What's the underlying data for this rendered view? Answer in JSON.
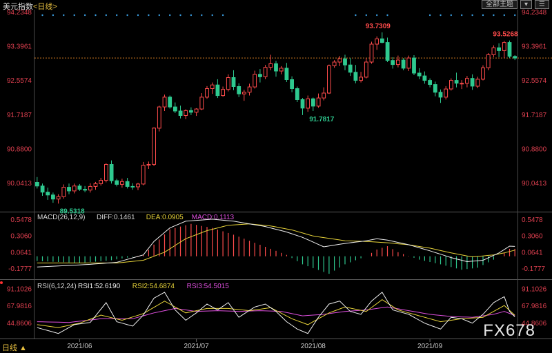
{
  "header": {
    "title": "美元指数",
    "period": "<日线>",
    "buttons": [
      "全部主题",
      "▾",
      "☰"
    ]
  },
  "footer": {
    "period_tab": "日线 ▲"
  },
  "watermark": "FX678",
  "colors": {
    "up": "#ff4b4b",
    "down": "#2ec98f",
    "dif": "#f0f0f0",
    "dea": "#e8d43a",
    "macd": "#e050e0",
    "rsi1": "#f0f0f0",
    "rsi2": "#e8d43a",
    "rsi3": "#e050e0",
    "axis_text": "#e04050",
    "marker_dots": "#3a9de0",
    "last_price_line": "#d07a20"
  },
  "chart_data": [
    {
      "type": "candlestick",
      "title": "美元指数<日线>",
      "y_ticks": [
        "94.2348",
        "93.3961",
        "92.5574",
        "91.7187",
        "90.8800",
        "90.0413"
      ],
      "ylim": [
        89.45,
        94.2348
      ],
      "x_ticks": [
        "2021/06",
        "2021/07",
        "2021/08",
        "2021/09"
      ],
      "x_tick_index": [
        8,
        30,
        52,
        74
      ],
      "annotations": [
        {
          "label": "89.5318",
          "index": 4,
          "kind": "low"
        },
        {
          "label": "91.7817",
          "index": 51,
          "kind": "low"
        },
        {
          "label": "93.7309",
          "index": 65,
          "kind": "high"
        },
        {
          "label": "93.5268",
          "index": 89,
          "kind": "high"
        }
      ],
      "last_price": 93.1,
      "candles": [
        [
          90.05,
          90.18,
          89.9,
          89.96
        ],
        [
          89.96,
          90.02,
          89.72,
          89.81
        ],
        [
          89.81,
          89.92,
          89.62,
          89.74
        ],
        [
          89.74,
          89.8,
          89.55,
          89.64
        ],
        [
          89.64,
          89.76,
          89.53,
          89.7
        ],
        [
          89.7,
          90.0,
          89.65,
          89.93
        ],
        [
          89.93,
          90.02,
          89.76,
          89.84
        ],
        [
          89.84,
          90.02,
          89.78,
          89.96
        ],
        [
          89.96,
          90.01,
          89.84,
          89.88
        ],
        [
          89.88,
          89.96,
          89.81,
          89.86
        ],
        [
          89.86,
          90.03,
          89.8,
          89.95
        ],
        [
          89.95,
          90.06,
          89.87,
          90.02
        ],
        [
          90.02,
          90.16,
          89.97,
          90.1
        ],
        [
          90.1,
          90.52,
          90.05,
          90.49
        ],
        [
          90.49,
          90.59,
          90.02,
          90.09
        ],
        [
          90.09,
          90.14,
          89.95,
          90.0
        ],
        [
          90.0,
          90.14,
          89.92,
          90.07
        ],
        [
          90.07,
          90.16,
          89.9,
          89.95
        ],
        [
          89.95,
          90.03,
          89.87,
          89.94
        ],
        [
          89.94,
          90.04,
          89.86,
          90.01
        ],
        [
          90.01,
          90.55,
          89.98,
          90.47
        ],
        [
          90.47,
          90.56,
          90.38,
          90.49
        ],
        [
          90.49,
          91.4,
          90.45,
          91.38
        ],
        [
          91.38,
          91.93,
          91.3,
          91.9
        ],
        [
          91.9,
          92.2,
          91.8,
          92.14
        ],
        [
          92.14,
          92.18,
          91.86,
          91.9
        ],
        [
          91.9,
          92.01,
          91.75,
          91.8
        ],
        [
          91.8,
          91.93,
          91.62,
          91.69
        ],
        [
          91.69,
          91.84,
          91.6,
          91.81
        ],
        [
          91.81,
          91.89,
          91.7,
          91.77
        ],
        [
          91.77,
          91.87,
          91.68,
          91.85
        ],
        [
          91.85,
          92.24,
          91.82,
          92.14
        ],
        [
          92.14,
          92.41,
          92.1,
          92.35
        ],
        [
          92.35,
          92.5,
          92.22,
          92.44
        ],
        [
          92.44,
          92.58,
          92.12,
          92.18
        ],
        [
          92.18,
          92.4,
          92.15,
          92.33
        ],
        [
          92.33,
          92.7,
          92.28,
          92.62
        ],
        [
          92.62,
          92.8,
          92.31,
          92.4
        ],
        [
          92.4,
          92.48,
          92.14,
          92.22
        ],
        [
          92.22,
          92.32,
          92.05,
          92.26
        ],
        [
          92.26,
          92.47,
          92.18,
          92.39
        ],
        [
          92.39,
          92.79,
          92.35,
          92.7
        ],
        [
          92.7,
          92.83,
          92.5,
          92.64
        ],
        [
          92.64,
          92.93,
          92.58,
          92.87
        ],
        [
          92.87,
          93.18,
          92.8,
          92.96
        ],
        [
          92.96,
          93.03,
          92.64,
          92.78
        ],
        [
          92.78,
          92.9,
          92.7,
          92.85
        ],
        [
          92.85,
          92.98,
          92.51,
          92.57
        ],
        [
          92.57,
          92.65,
          92.26,
          92.35
        ],
        [
          92.35,
          92.4,
          92.02,
          92.08
        ],
        [
          92.08,
          92.12,
          91.7,
          91.87
        ],
        [
          91.87,
          92.18,
          91.78,
          92.1
        ],
        [
          92.1,
          92.13,
          91.8,
          91.92
        ],
        [
          91.92,
          92.23,
          91.88,
          92.12
        ],
        [
          92.12,
          92.38,
          92.06,
          92.24
        ],
        [
          92.24,
          92.94,
          92.22,
          92.91
        ],
        [
          92.91,
          93.05,
          92.86,
          93.0
        ],
        [
          93.0,
          93.15,
          92.9,
          93.08
        ],
        [
          93.08,
          93.18,
          92.8,
          92.93
        ],
        [
          92.93,
          93.1,
          92.66,
          92.75
        ],
        [
          92.75,
          92.93,
          92.48,
          92.55
        ],
        [
          92.55,
          92.76,
          92.5,
          92.63
        ],
        [
          92.63,
          93.1,
          92.6,
          93.0
        ],
        [
          93.0,
          93.5,
          92.96,
          93.44
        ],
        [
          93.44,
          93.63,
          93.3,
          93.57
        ],
        [
          93.57,
          93.73,
          93.46,
          93.48
        ],
        [
          93.48,
          93.6,
          93.0,
          93.04
        ],
        [
          93.04,
          93.12,
          92.84,
          92.94
        ],
        [
          92.94,
          93.16,
          92.87,
          93.05
        ],
        [
          93.05,
          93.1,
          92.8,
          92.85
        ],
        [
          92.85,
          93.16,
          92.78,
          93.1
        ],
        [
          93.1,
          93.17,
          92.68,
          92.73
        ],
        [
          92.73,
          92.85,
          92.58,
          92.66
        ],
        [
          92.66,
          92.77,
          92.47,
          92.55
        ],
        [
          92.55,
          92.6,
          92.38,
          92.45
        ],
        [
          92.45,
          92.52,
          92.16,
          92.26
        ],
        [
          92.26,
          92.33,
          92.0,
          92.14
        ],
        [
          92.14,
          92.41,
          92.08,
          92.34
        ],
        [
          92.34,
          92.6,
          92.3,
          92.55
        ],
        [
          92.55,
          92.74,
          92.38,
          92.48
        ],
        [
          92.48,
          92.56,
          92.34,
          92.48
        ],
        [
          92.48,
          92.66,
          92.38,
          92.6
        ],
        [
          92.6,
          92.7,
          92.32,
          92.41
        ],
        [
          92.41,
          92.64,
          92.36,
          92.58
        ],
        [
          92.58,
          92.92,
          92.55,
          92.86
        ],
        [
          92.86,
          93.22,
          92.8,
          93.18
        ],
        [
          93.18,
          93.41,
          93.12,
          93.35
        ],
        [
          93.35,
          93.46,
          93.12,
          93.28
        ],
        [
          93.28,
          93.52,
          93.1,
          93.48
        ],
        [
          93.48,
          93.53,
          93.1,
          93.14
        ],
        [
          93.14,
          93.17,
          93.05,
          93.1
        ]
      ]
    },
    {
      "type": "line",
      "title": "MACD(26,12,9)",
      "labels": [
        {
          "name": "DIFF",
          "text": "DIFF:0.1461"
        },
        {
          "name": "DEA",
          "text": "DEA:0.0905"
        },
        {
          "name": "MACD",
          "text": "MACD:0.1113"
        }
      ],
      "y_ticks": [
        "0.5478",
        "0.3060",
        "0.0641",
        "-0.1777"
      ],
      "ylim": [
        -0.3,
        0.6
      ],
      "macd_keypoints": [
        [
          0,
          -0.07
        ],
        [
          8,
          -0.1
        ],
        [
          14,
          -0.06
        ],
        [
          20,
          0.02
        ],
        [
          25,
          0.4
        ],
        [
          29,
          0.48
        ],
        [
          33,
          0.42
        ],
        [
          37,
          0.32
        ],
        [
          43,
          0.14
        ],
        [
          47,
          0.02
        ],
        [
          50,
          -0.12
        ],
        [
          55,
          -0.26
        ],
        [
          58,
          -0.12
        ],
        [
          62,
          0.0
        ],
        [
          64,
          0.1
        ],
        [
          66,
          0.15
        ],
        [
          68,
          0.06
        ],
        [
          72,
          -0.05
        ],
        [
          76,
          -0.12
        ],
        [
          80,
          -0.2
        ],
        [
          83,
          -0.17
        ],
        [
          86,
          -0.05
        ],
        [
          88,
          0.05
        ],
        [
          89,
          0.11
        ],
        [
          90,
          0.11
        ]
      ],
      "diff_keypoints": [
        [
          0,
          -0.16
        ],
        [
          10,
          -0.12
        ],
        [
          15,
          -0.09
        ],
        [
          20,
          0.02
        ],
        [
          22,
          0.22
        ],
        [
          25,
          0.42
        ],
        [
          28,
          0.52
        ],
        [
          33,
          0.55
        ],
        [
          37,
          0.52
        ],
        [
          43,
          0.44
        ],
        [
          47,
          0.36
        ],
        [
          50,
          0.28
        ],
        [
          54,
          0.14
        ],
        [
          58,
          0.19
        ],
        [
          62,
          0.23
        ],
        [
          64,
          0.26
        ],
        [
          66,
          0.24
        ],
        [
          70,
          0.17
        ],
        [
          74,
          0.08
        ],
        [
          78,
          -0.02
        ],
        [
          81,
          -0.08
        ],
        [
          84,
          -0.06
        ],
        [
          87,
          0.05
        ],
        [
          89,
          0.15
        ],
        [
          90,
          0.1461
        ]
      ],
      "dea_keypoints": [
        [
          0,
          -0.1
        ],
        [
          15,
          -0.1
        ],
        [
          20,
          -0.06
        ],
        [
          24,
          0.06
        ],
        [
          28,
          0.26
        ],
        [
          32,
          0.38
        ],
        [
          36,
          0.46
        ],
        [
          40,
          0.48
        ],
        [
          44,
          0.45
        ],
        [
          48,
          0.39
        ],
        [
          52,
          0.3
        ],
        [
          58,
          0.23
        ],
        [
          62,
          0.22
        ],
        [
          66,
          0.2
        ],
        [
          70,
          0.17
        ],
        [
          74,
          0.12
        ],
        [
          78,
          0.05
        ],
        [
          82,
          -0.01
        ],
        [
          86,
          0.02
        ],
        [
          88,
          0.05
        ],
        [
          90,
          0.0905
        ]
      ]
    },
    {
      "type": "line",
      "title": "RSI(6,12,24)",
      "labels": [
        {
          "name": "RSI1",
          "text": "RSI1:52.6190"
        },
        {
          "name": "RSI2",
          "text": "RSI2:54.6874"
        },
        {
          "name": "RSI3",
          "text": "RSI3:54.5015"
        }
      ],
      "y_ticks": [
        "91.1026",
        "67.9816",
        "44.8606"
      ],
      "ylim": [
        25,
        100
      ],
      "rsi1_keypoints": [
        [
          0,
          38
        ],
        [
          4,
          30
        ],
        [
          7,
          42
        ],
        [
          10,
          45
        ],
        [
          13,
          72
        ],
        [
          15,
          46
        ],
        [
          18,
          40
        ],
        [
          20,
          55
        ],
        [
          22,
          78
        ],
        [
          24,
          86
        ],
        [
          26,
          62
        ],
        [
          28,
          48
        ],
        [
          30,
          58
        ],
        [
          32,
          70
        ],
        [
          34,
          62
        ],
        [
          36,
          72
        ],
        [
          38,
          52
        ],
        [
          41,
          66
        ],
        [
          43,
          70
        ],
        [
          45,
          60
        ],
        [
          47,
          46
        ],
        [
          49,
          36
        ],
        [
          51,
          30
        ],
        [
          53,
          52
        ],
        [
          55,
          70
        ],
        [
          57,
          74
        ],
        [
          59,
          60
        ],
        [
          61,
          56
        ],
        [
          63,
          74
        ],
        [
          65,
          86
        ],
        [
          67,
          62
        ],
        [
          70,
          56
        ],
        [
          73,
          44
        ],
        [
          76,
          36
        ],
        [
          78,
          52
        ],
        [
          80,
          50
        ],
        [
          82,
          44
        ],
        [
          84,
          56
        ],
        [
          86,
          72
        ],
        [
          88,
          80
        ],
        [
          89,
          60
        ],
        [
          90,
          52.6
        ]
      ],
      "rsi2_keypoints": [
        [
          0,
          42
        ],
        [
          4,
          38
        ],
        [
          8,
          44
        ],
        [
          12,
          55
        ],
        [
          16,
          48
        ],
        [
          20,
          57
        ],
        [
          24,
          74
        ],
        [
          28,
          58
        ],
        [
          32,
          64
        ],
        [
          36,
          64
        ],
        [
          40,
          61
        ],
        [
          44,
          65
        ],
        [
          48,
          50
        ],
        [
          51,
          42
        ],
        [
          55,
          58
        ],
        [
          58,
          66
        ],
        [
          62,
          60
        ],
        [
          65,
          76
        ],
        [
          68,
          62
        ],
        [
          72,
          54
        ],
        [
          76,
          46
        ],
        [
          80,
          50
        ],
        [
          84,
          52
        ],
        [
          88,
          68
        ],
        [
          90,
          54.7
        ]
      ],
      "rsi3_keypoints": [
        [
          0,
          46
        ],
        [
          6,
          45
        ],
        [
          12,
          50
        ],
        [
          18,
          50
        ],
        [
          22,
          58
        ],
        [
          26,
          64
        ],
        [
          30,
          60
        ],
        [
          34,
          61
        ],
        [
          38,
          60
        ],
        [
          42,
          61
        ],
        [
          46,
          60
        ],
        [
          50,
          54
        ],
        [
          54,
          56
        ],
        [
          58,
          60
        ],
        [
          62,
          62
        ],
        [
          66,
          66
        ],
        [
          70,
          61
        ],
        [
          74,
          56
        ],
        [
          78,
          53
        ],
        [
          82,
          52
        ],
        [
          86,
          56
        ],
        [
          88,
          60
        ],
        [
          90,
          54.5
        ]
      ]
    }
  ]
}
